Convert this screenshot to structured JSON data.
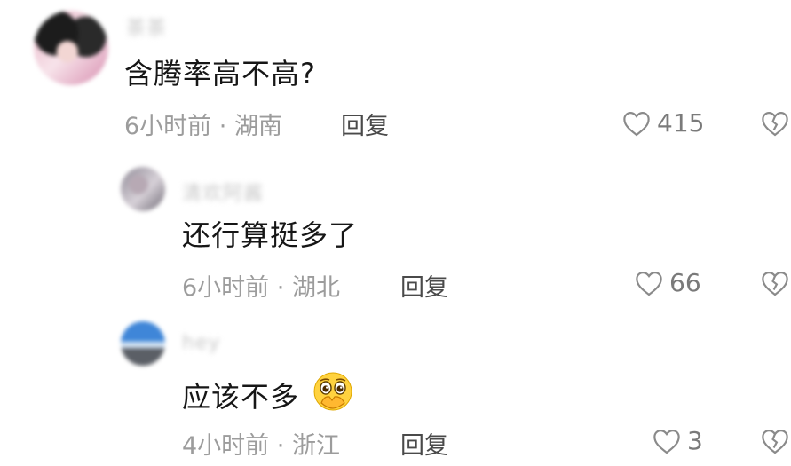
{
  "comments": [
    {
      "username": "茶茶",
      "text": "含腾率高不高?",
      "time": "6小时前",
      "location": "湖南",
      "reply_label": "回复",
      "likes": "415"
    },
    {
      "username": "清欢阿酱",
      "text": "还行算挺多了",
      "time": "6小时前",
      "location": "湖北",
      "reply_label": "回复",
      "likes": "66"
    },
    {
      "username": "hey",
      "text": "应该不多",
      "time": "4小时前",
      "location": "浙江",
      "reply_label": "回复",
      "likes": "3"
    }
  ],
  "separator": "·",
  "icons": {
    "like": "heart-outline-icon",
    "dislike": "broken-heart-icon",
    "emoji": "covering-mouth-emoji"
  },
  "colors": {
    "text": "#161616",
    "meta": "#9c9c9c",
    "reply": "#4a4a4a"
  }
}
